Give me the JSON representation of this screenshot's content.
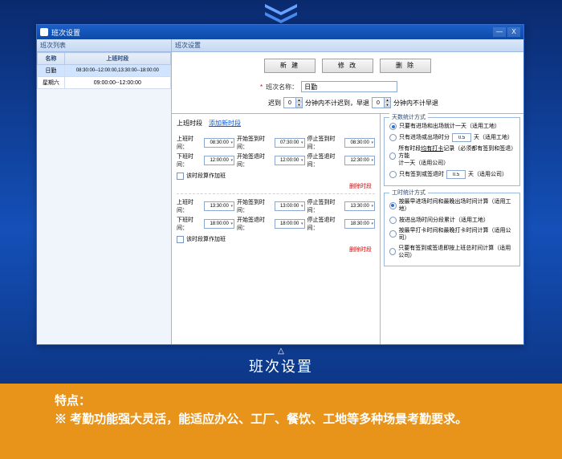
{
  "window": {
    "title": "班次设置",
    "minimize": "—",
    "close": "X"
  },
  "left": {
    "header": "班次列表",
    "cols": [
      "名称",
      "上班时段"
    ],
    "rows": [
      {
        "name": "日勤",
        "period": "08:30:00--12:00:00,13:30:00--18:00:00"
      },
      {
        "name": "星期六",
        "period": "09:00:00--12:00:00"
      }
    ]
  },
  "right": {
    "header": "班次设置",
    "buttons": {
      "new": "新 建",
      "edit": "修 改",
      "delete": "删 除"
    },
    "name_label": "班次名称：",
    "name_value": "日勤",
    "late_label": "迟到",
    "late_val": "0",
    "late_suffix": "分钟内不计迟到，早退",
    "early_val": "0",
    "early_suffix": "分钟内不计早退"
  },
  "periods": {
    "head": "上班时段",
    "add": "添加新时段",
    "labels": {
      "on": "上班时间：",
      "off": "下班时间：",
      "startCheck": "开始签到时间：",
      "stopCheck": "停止签到时间：",
      "startOut": "开始签退时间：",
      "stopOut": "停止签退时间：",
      "ot": "该时段算作加班",
      "del": "删除时段"
    },
    "block1": {
      "on": "08:30:00",
      "startCheck": "07:30:00",
      "stopCheck": "08:30:00",
      "off": "12:00:00",
      "startOut": "12:00:00",
      "stopOut": "12:30:00"
    },
    "block2": {
      "on": "13:30:00",
      "startCheck": "13:00:00",
      "stopCheck": "13:30:00",
      "off": "18:00:00",
      "startOut": "18:00:00",
      "stopOut": "18:30:00"
    }
  },
  "daystat": {
    "title": "天数统计方式",
    "r1": "只要有进场和出场就计一天（适用工地）",
    "r2a": "只有进场或出场时分",
    "r2v": "0.5",
    "r2b": "天（适用工地）",
    "r3a": "所有时段",
    "r3b": "均有打卡",
    "r3c": "记录（必须都有签到和签退）方能",
    "r3d": "计一天（适用公司）",
    "r4a": "只有签到或签退时",
    "r4v": "0.5",
    "r4b": "天（适用公司）"
  },
  "workstat": {
    "title": "工时统计方式",
    "r1": "按最早进场时间和最晚出场时间计算（适用工地）",
    "r2": "按进出场时间分段累计（适用工地）",
    "r3": "按最早打卡时间和最晚打卡时间计算（适用公司）",
    "r4": "只要有签到或签退即按上班总时间计算（适用公司）"
  },
  "caption": "班次设置",
  "features": {
    "title": "特点：",
    "body": "※ 考勤功能强大灵活，能适应办公、工厂、餐饮、工地等多种场景考勤要求。"
  }
}
